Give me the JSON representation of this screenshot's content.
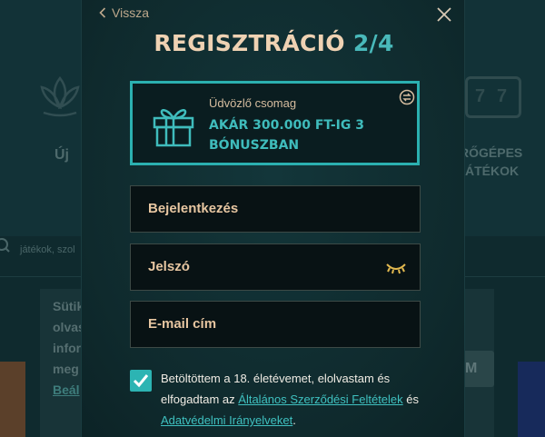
{
  "background": {
    "nav_new_label": "Új",
    "nav_slots_label_line1": "RŐGÉPES",
    "nav_slots_label_line2": "ÁTÉKOK",
    "slot_digits": [
      "7",
      "7"
    ],
    "search_placeholder": "játékok, szol",
    "cookie_lines": [
      "Sütik",
      "olvas",
      "infor",
      "meg",
      "Beál"
    ],
    "cookie_button": "M"
  },
  "modal": {
    "back_label": "Vissza",
    "title_main": "REGISZTRÁCIÓ",
    "title_step": "2/4",
    "promo": {
      "subtitle": "Üdvözlő csomag",
      "headline": "AKÁR 300.000 FT-IG 3 BÓNUSZBAN"
    },
    "fields": {
      "login_placeholder": "Bejelentkezés",
      "password_placeholder": "Jelszó",
      "email_placeholder": "E-mail cím"
    },
    "consent": {
      "checked": true,
      "text_before": "Betöltöttem a 18. életévemet, elolvastam és elfogadtam az ",
      "terms_link": "Általános Szerződési Feltételek",
      "text_middle": " és ",
      "privacy_link": "Adatvédelmi Irányelveket",
      "text_after": "."
    }
  },
  "colors": {
    "accent_teal": "#2cb4b3",
    "title_cream": "#efd2b3",
    "label_gold": "#e7c6a1"
  }
}
